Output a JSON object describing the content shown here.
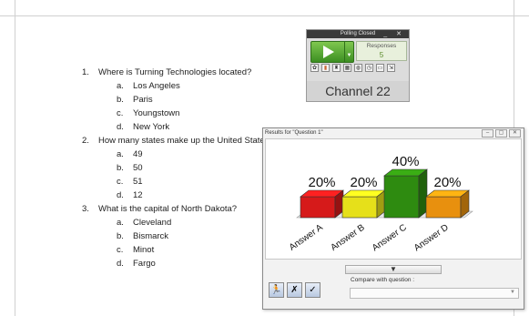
{
  "document": {
    "questions": [
      {
        "number": "1.",
        "text": "Where is Turning Technologies located?",
        "answers": [
          {
            "letter": "a.",
            "text": "Los Angeles"
          },
          {
            "letter": "b.",
            "text": "Paris"
          },
          {
            "letter": "c.",
            "text": "Youngstown"
          },
          {
            "letter": "d.",
            "text": "New York"
          }
        ]
      },
      {
        "number": "2.",
        "text": "How many states make up the United States",
        "answers": [
          {
            "letter": "a.",
            "text": "49"
          },
          {
            "letter": "b.",
            "text": "50"
          },
          {
            "letter": "c.",
            "text": "51"
          },
          {
            "letter": "d.",
            "text": "12"
          }
        ]
      },
      {
        "number": "3.",
        "text": "What is the capital of North Dakota?",
        "answers": [
          {
            "letter": "a.",
            "text": "Cleveland"
          },
          {
            "letter": "b.",
            "text": "Bismarck"
          },
          {
            "letter": "c.",
            "text": "Minot"
          },
          {
            "letter": "d.",
            "text": "Fargo"
          }
        ]
      }
    ]
  },
  "poll_widget": {
    "status": "Polling Closed",
    "window_controls": "_ ✕",
    "responses_label": "Responses",
    "responses_count": "5",
    "channel": "Channel 22"
  },
  "results_window": {
    "title": "Results for \"Question 1\"",
    "compare_label": "Compare with question :",
    "expander_icon": "▼"
  },
  "chart_data": {
    "type": "bar",
    "categories": [
      "Answer A",
      "Answer B",
      "Answer C",
      "Answer D"
    ],
    "values": [
      20,
      20,
      40,
      20
    ],
    "value_labels": [
      "20%",
      "20%",
      "40%",
      "20%"
    ],
    "colors": [
      "#d61a1a",
      "#e6e01a",
      "#2e8b10",
      "#e8900e"
    ],
    "ylim": [
      0,
      100
    ],
    "title": "",
    "xlabel": "",
    "ylabel": ""
  }
}
